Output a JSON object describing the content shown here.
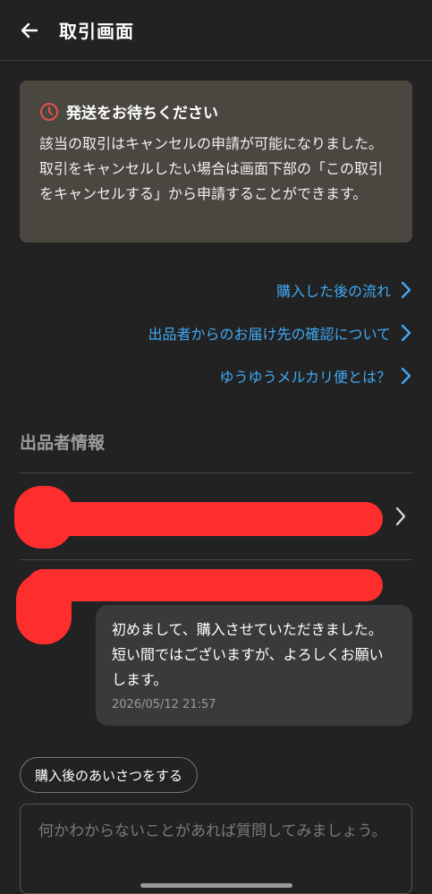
{
  "header": {
    "title": "取引画面"
  },
  "notice": {
    "title": "発送をお待ちください",
    "body": "該当の取引はキャンセルの申請が可能になりました。取引をキャンセルしたい場合は画面下部の「この取引をキャンセルする」から申請することができます。"
  },
  "links": [
    {
      "label": "購入した後の流れ"
    },
    {
      "label": "出品者からのお届け先の確認について"
    },
    {
      "label": "ゆうゆうメルカリ便とは？"
    }
  ],
  "seller_section": {
    "title": "出品者情報"
  },
  "message": {
    "text": "初めまして、購入させていただきました。短い間ではございますが、よろしくお願いします。",
    "timestamp": "2026/05/12 21:57"
  },
  "greeting_button": {
    "label": "購入後のあいさつをする"
  },
  "question": {
    "placeholder": "何かわからないことがあれば質問してみましょう。"
  },
  "colors": {
    "accent_link": "#3fa9f5",
    "notice_bg": "#4a4740",
    "redaction": "#ff2e2e",
    "clock_icon": "#e0524a"
  }
}
